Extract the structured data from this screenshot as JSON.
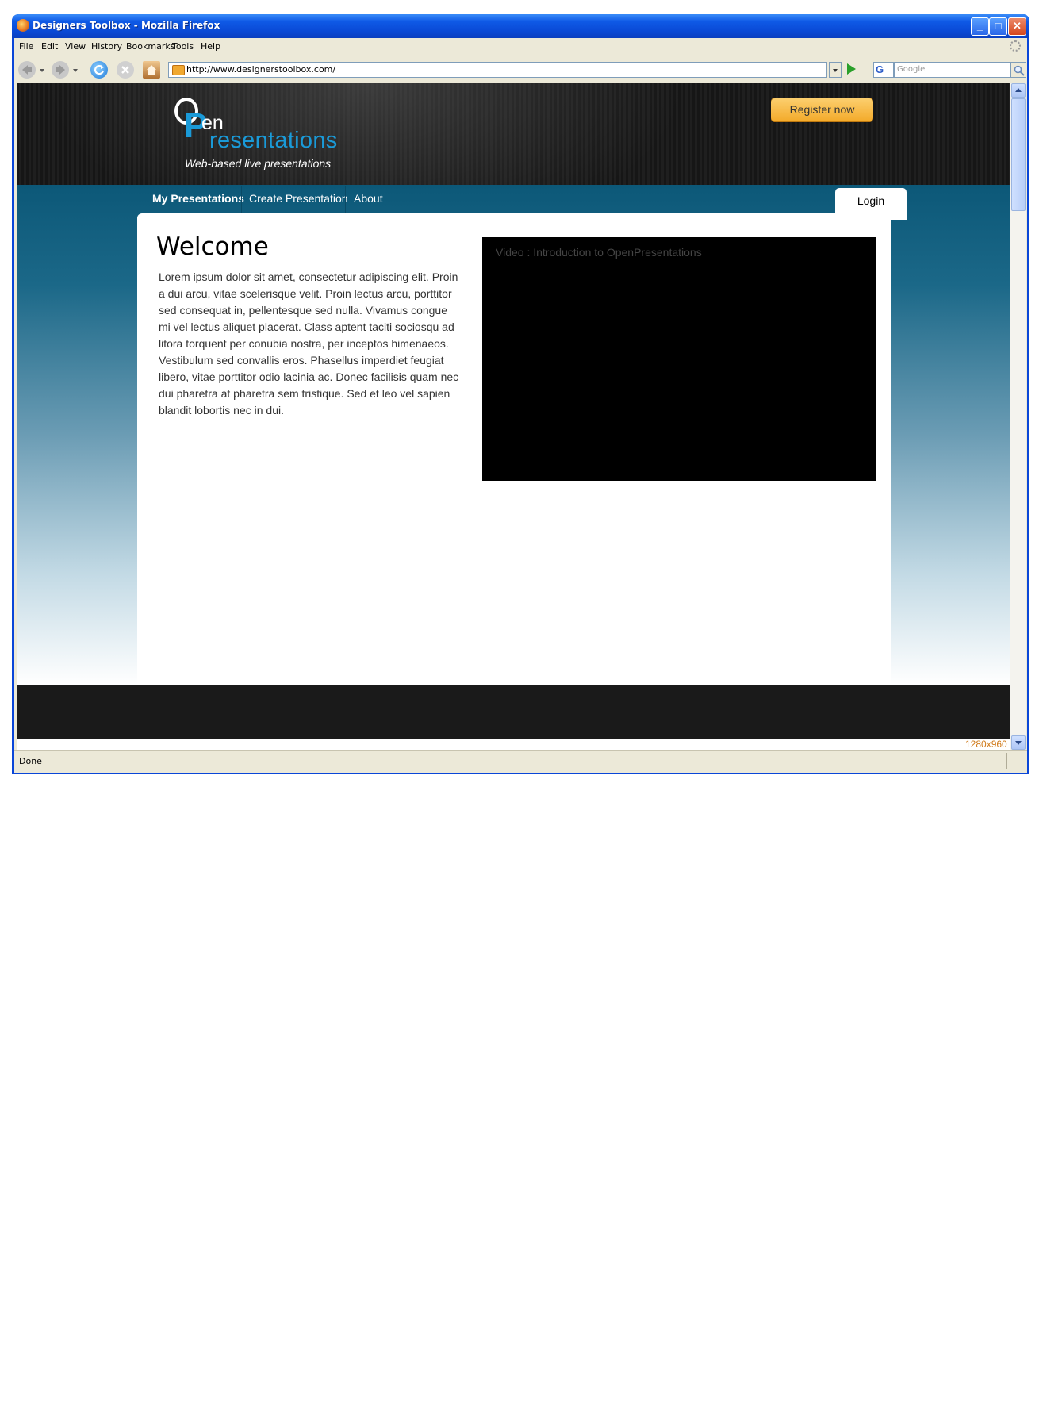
{
  "window": {
    "title": "Designers Toolbox  - Mozilla Firefox",
    "controls": {
      "minimize": "_",
      "maximize": "□",
      "close": "✕"
    }
  },
  "menu": {
    "items": [
      "File",
      "Edit",
      "View",
      "History",
      "Bookmarks",
      "Tools",
      "Help"
    ]
  },
  "toolbar": {
    "url": "http://www.designerstoolbox.com/",
    "search_engine_icon": "G",
    "search_placeholder": "Google"
  },
  "site": {
    "logo": {
      "o": "O",
      "p": "P",
      "en": "en",
      "resentations": "resentations"
    },
    "tagline": "Web-based live presentations",
    "register_label": "Register now",
    "nav": [
      "My Presentations",
      "Create Presentation",
      "About"
    ],
    "login_label": "Login",
    "heading": "Welcome",
    "body_text": "Lorem ipsum dolor sit amet, consectetur adipiscing elit. Proin a dui arcu, vitae scelerisque velit. Proin lectus arcu, porttitor sed consequat in, pellentesque sed nulla. Vivamus congue mi vel lectus aliquet placerat. Class aptent taciti sociosqu ad litora torquent per conubia nostra, per inceptos himenaeos. Vestibulum sed convallis eros. Phasellus imperdiet feugiat libero, vitae porttitor odio lacinia ac. Donec facilisis quam nec dui pharetra at pharetra sem tristique. Sed et leo vel sapien blandit lobortis nec in dui.",
    "video_title": "Video : Introduction to OpenPresentations",
    "dimension_label": "1280x960"
  },
  "status": {
    "text": "Done"
  },
  "colors": {
    "titlebar": "#0a4ad6",
    "brand_blue": "#1a9ad8",
    "register_orange": "#f3a928",
    "nav_teal": "#0c5878",
    "footer": "#1a1a1a",
    "dimension_label": "#d07a1a"
  },
  "icons": [
    "firefox-icon",
    "back-icon",
    "forward-icon",
    "reload-icon",
    "stop-icon",
    "home-icon",
    "page-icon",
    "go-icon",
    "magnifier-icon",
    "throbber-icon"
  ]
}
